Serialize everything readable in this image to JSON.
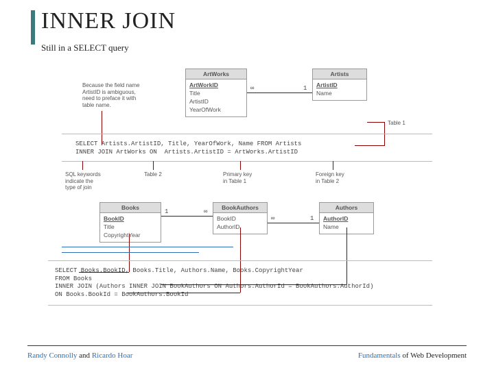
{
  "title": "INNER JOIN",
  "subtitle": "Still in a SELECT query",
  "tables": {
    "artworks": {
      "name": "ArtWorks",
      "fields": [
        "ArtWorkID",
        "Title",
        "ArtistID",
        "YearOfWork"
      ],
      "pk_index": 0
    },
    "artists": {
      "name": "Artists",
      "fields": [
        "ArtistID",
        "Name"
      ],
      "pk_index": 0
    },
    "books": {
      "name": "Books",
      "fields": [
        "BookID",
        "Title",
        "CopyrightYear"
      ],
      "pk_index": 0
    },
    "bookauthors": {
      "name": "BookAuthors",
      "fields": [
        "BookID",
        "AuthorID"
      ],
      "pk_index": -1
    },
    "authors": {
      "name": "Authors",
      "fields": [
        "AuthorID",
        "Name"
      ],
      "pk_index": 0
    }
  },
  "sql1": "SELECT Artists.ArtistID, Title, YearOfWork, Name FROM Artists\nINNER JOIN ArtWorks ON  Artists.ArtistID = ArtWorks.ArtistID",
  "sql2": "SELECT Books.BookID, Books.Title, Authors.Name, Books.CopyrightYear\nFROM Books\nINNER JOIN (Authors INNER JOIN BookAuthors ON Authors.AuthorId = BookAuthors.AuthorId)\nON Books.BookId = BookAuthors.BookId",
  "annotations": {
    "ambiguous": "Because the field name\nArtistID is ambiguous,\nneed to preface it with\ntable name.",
    "table1": "Table 1",
    "sql_keywords": "SQL keywords\nindicate the\ntype of join",
    "table2": "Table 2",
    "pk_t1": "Primary key\nin Table 1",
    "fk_t2": "Foreign key\nin Table 2"
  },
  "cardinality": {
    "one": "1",
    "many": "∞"
  },
  "footer": {
    "left_linked_1": "Randy Connolly",
    "left_plain": " and ",
    "left_linked_2": "Ricardo Hoar",
    "right_linked": "Fundamentals",
    "right_plain": " of Web Development"
  }
}
